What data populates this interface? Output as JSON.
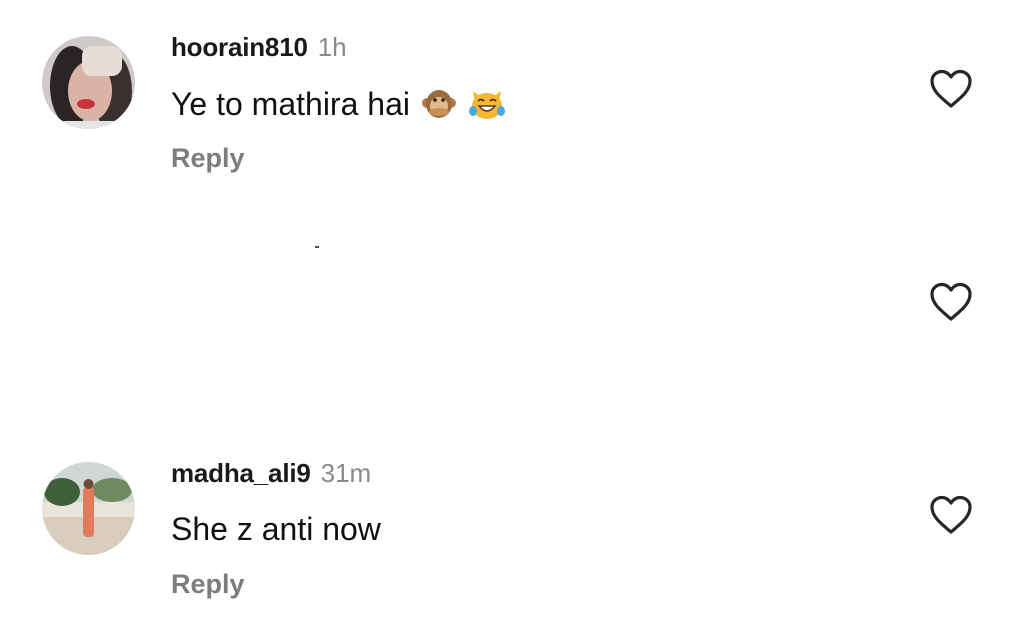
{
  "comments": [
    {
      "username": "hoorain810",
      "time": "1h",
      "text": "Ye to mathira hai",
      "emojis": [
        "speak-no-evil-monkey-icon",
        "cat-tears-of-joy-icon"
      ],
      "reply_label": "Reply"
    },
    {
      "username": "madha_ali9",
      "time": "31m",
      "text": "She z anti now",
      "reply_label": "Reply"
    }
  ],
  "icons": {
    "like": "heart-outline-icon"
  },
  "colors": {
    "username": "#1a1a1a",
    "timestamp": "#8a8a8a",
    "reply": "#7d7d7d",
    "heart_stroke": "#262626"
  }
}
